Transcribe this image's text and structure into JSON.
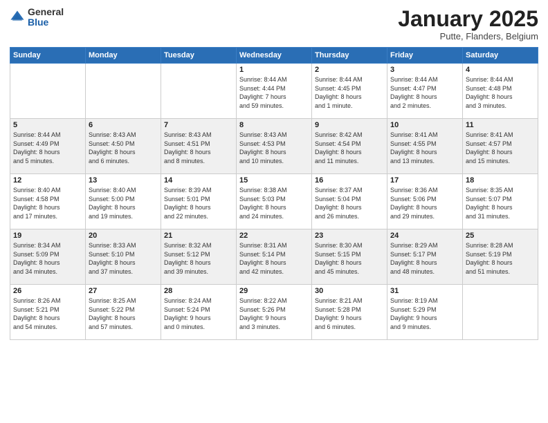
{
  "logo": {
    "general": "General",
    "blue": "Blue"
  },
  "header": {
    "month_title": "January 2025",
    "subtitle": "Putte, Flanders, Belgium"
  },
  "days_of_week": [
    "Sunday",
    "Monday",
    "Tuesday",
    "Wednesday",
    "Thursday",
    "Friday",
    "Saturday"
  ],
  "weeks": [
    [
      {
        "day": "",
        "info": ""
      },
      {
        "day": "",
        "info": ""
      },
      {
        "day": "",
        "info": ""
      },
      {
        "day": "1",
        "info": "Sunrise: 8:44 AM\nSunset: 4:44 PM\nDaylight: 7 hours\nand 59 minutes."
      },
      {
        "day": "2",
        "info": "Sunrise: 8:44 AM\nSunset: 4:45 PM\nDaylight: 8 hours\nand 1 minute."
      },
      {
        "day": "3",
        "info": "Sunrise: 8:44 AM\nSunset: 4:47 PM\nDaylight: 8 hours\nand 2 minutes."
      },
      {
        "day": "4",
        "info": "Sunrise: 8:44 AM\nSunset: 4:48 PM\nDaylight: 8 hours\nand 3 minutes."
      }
    ],
    [
      {
        "day": "5",
        "info": "Sunrise: 8:44 AM\nSunset: 4:49 PM\nDaylight: 8 hours\nand 5 minutes."
      },
      {
        "day": "6",
        "info": "Sunrise: 8:43 AM\nSunset: 4:50 PM\nDaylight: 8 hours\nand 6 minutes."
      },
      {
        "day": "7",
        "info": "Sunrise: 8:43 AM\nSunset: 4:51 PM\nDaylight: 8 hours\nand 8 minutes."
      },
      {
        "day": "8",
        "info": "Sunrise: 8:43 AM\nSunset: 4:53 PM\nDaylight: 8 hours\nand 10 minutes."
      },
      {
        "day": "9",
        "info": "Sunrise: 8:42 AM\nSunset: 4:54 PM\nDaylight: 8 hours\nand 11 minutes."
      },
      {
        "day": "10",
        "info": "Sunrise: 8:41 AM\nSunset: 4:55 PM\nDaylight: 8 hours\nand 13 minutes."
      },
      {
        "day": "11",
        "info": "Sunrise: 8:41 AM\nSunset: 4:57 PM\nDaylight: 8 hours\nand 15 minutes."
      }
    ],
    [
      {
        "day": "12",
        "info": "Sunrise: 8:40 AM\nSunset: 4:58 PM\nDaylight: 8 hours\nand 17 minutes."
      },
      {
        "day": "13",
        "info": "Sunrise: 8:40 AM\nSunset: 5:00 PM\nDaylight: 8 hours\nand 19 minutes."
      },
      {
        "day": "14",
        "info": "Sunrise: 8:39 AM\nSunset: 5:01 PM\nDaylight: 8 hours\nand 22 minutes."
      },
      {
        "day": "15",
        "info": "Sunrise: 8:38 AM\nSunset: 5:03 PM\nDaylight: 8 hours\nand 24 minutes."
      },
      {
        "day": "16",
        "info": "Sunrise: 8:37 AM\nSunset: 5:04 PM\nDaylight: 8 hours\nand 26 minutes."
      },
      {
        "day": "17",
        "info": "Sunrise: 8:36 AM\nSunset: 5:06 PM\nDaylight: 8 hours\nand 29 minutes."
      },
      {
        "day": "18",
        "info": "Sunrise: 8:35 AM\nSunset: 5:07 PM\nDaylight: 8 hours\nand 31 minutes."
      }
    ],
    [
      {
        "day": "19",
        "info": "Sunrise: 8:34 AM\nSunset: 5:09 PM\nDaylight: 8 hours\nand 34 minutes."
      },
      {
        "day": "20",
        "info": "Sunrise: 8:33 AM\nSunset: 5:10 PM\nDaylight: 8 hours\nand 37 minutes."
      },
      {
        "day": "21",
        "info": "Sunrise: 8:32 AM\nSunset: 5:12 PM\nDaylight: 8 hours\nand 39 minutes."
      },
      {
        "day": "22",
        "info": "Sunrise: 8:31 AM\nSunset: 5:14 PM\nDaylight: 8 hours\nand 42 minutes."
      },
      {
        "day": "23",
        "info": "Sunrise: 8:30 AM\nSunset: 5:15 PM\nDaylight: 8 hours\nand 45 minutes."
      },
      {
        "day": "24",
        "info": "Sunrise: 8:29 AM\nSunset: 5:17 PM\nDaylight: 8 hours\nand 48 minutes."
      },
      {
        "day": "25",
        "info": "Sunrise: 8:28 AM\nSunset: 5:19 PM\nDaylight: 8 hours\nand 51 minutes."
      }
    ],
    [
      {
        "day": "26",
        "info": "Sunrise: 8:26 AM\nSunset: 5:21 PM\nDaylight: 8 hours\nand 54 minutes."
      },
      {
        "day": "27",
        "info": "Sunrise: 8:25 AM\nSunset: 5:22 PM\nDaylight: 8 hours\nand 57 minutes."
      },
      {
        "day": "28",
        "info": "Sunrise: 8:24 AM\nSunset: 5:24 PM\nDaylight: 9 hours\nand 0 minutes."
      },
      {
        "day": "29",
        "info": "Sunrise: 8:22 AM\nSunset: 5:26 PM\nDaylight: 9 hours\nand 3 minutes."
      },
      {
        "day": "30",
        "info": "Sunrise: 8:21 AM\nSunset: 5:28 PM\nDaylight: 9 hours\nand 6 minutes."
      },
      {
        "day": "31",
        "info": "Sunrise: 8:19 AM\nSunset: 5:29 PM\nDaylight: 9 hours\nand 9 minutes."
      },
      {
        "day": "",
        "info": ""
      }
    ]
  ]
}
